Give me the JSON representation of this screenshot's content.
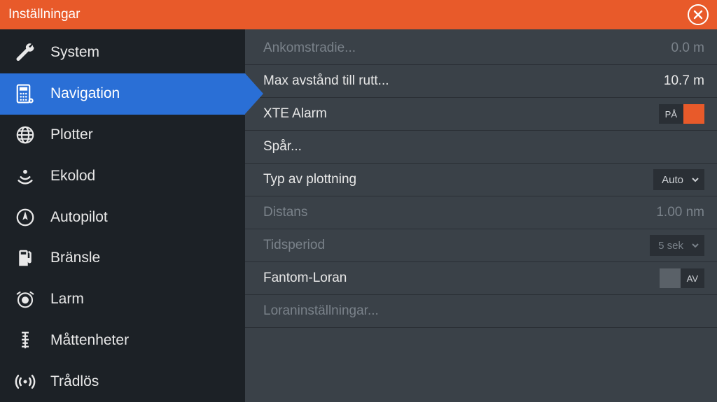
{
  "title": "Inställningar",
  "sidebar": {
    "items": [
      {
        "label": "System"
      },
      {
        "label": "Navigation"
      },
      {
        "label": "Plotter"
      },
      {
        "label": "Ekolod"
      },
      {
        "label": "Autopilot"
      },
      {
        "label": "Bränsle"
      },
      {
        "label": "Larm"
      },
      {
        "label": "Måttenheter"
      },
      {
        "label": "Trådlös"
      }
    ],
    "selected": 1
  },
  "rows": {
    "arrival_radius": {
      "label": "Ankomstradie...",
      "value": "0.0 m"
    },
    "max_dist": {
      "label": "Max avstånd till rutt...",
      "value": "10.7 m"
    },
    "xte_alarm": {
      "label": "XTE Alarm",
      "toggle": "PÅ"
    },
    "track": {
      "label": "Spår..."
    },
    "plot_type": {
      "label": "Typ av plottning",
      "dropdown": "Auto"
    },
    "distance": {
      "label": "Distans",
      "value": "1.00 nm"
    },
    "time_period": {
      "label": "Tidsperiod",
      "dropdown": "5 sek"
    },
    "fantom_loran": {
      "label": "Fantom-Loran",
      "toggle": "AV"
    },
    "loran_settings": {
      "label": "Loraninställningar..."
    }
  }
}
